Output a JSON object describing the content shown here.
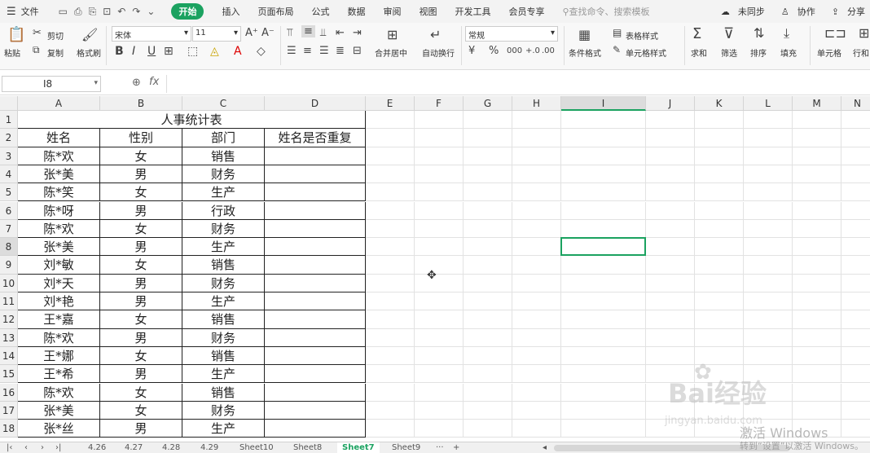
{
  "menubar": {
    "file": "文件",
    "tabs": [
      {
        "label": "开始",
        "active": true
      },
      {
        "label": "插入"
      },
      {
        "label": "页面布局"
      },
      {
        "label": "公式"
      },
      {
        "label": "数据"
      },
      {
        "label": "审阅"
      },
      {
        "label": "视图"
      },
      {
        "label": "开发工具"
      },
      {
        "label": "会员专享"
      }
    ],
    "search": "查找命令、搜索模板",
    "unsync": "未同步",
    "collab": "协作",
    "share": "分享"
  },
  "ribbon": {
    "paste": "粘贴",
    "cut": "剪切",
    "copy": "复制",
    "format_painter": "格式刷",
    "font_name": "宋体",
    "font_size": "11",
    "merge": "合并居中",
    "wrap": "自动换行",
    "number_format": "常规",
    "cond_format": "条件格式",
    "table_style": "表格样式",
    "cell_style": "单元格样式",
    "sum": "求和",
    "filter": "筛选",
    "sort": "排序",
    "fill": "填充",
    "cell": "单元格",
    "rowcol": "行和"
  },
  "formula_bar": {
    "name_box": "I8",
    "fx": "fx",
    "content": ""
  },
  "columns": [
    "A",
    "B",
    "C",
    "D",
    "E",
    "F",
    "G",
    "H",
    "I",
    "J",
    "K",
    "L",
    "M",
    "N"
  ],
  "rows": [
    "1",
    "2",
    "3",
    "4",
    "5",
    "6",
    "7",
    "8",
    "9",
    "10",
    "11",
    "12",
    "13",
    "14",
    "15",
    "16",
    "17",
    "18"
  ],
  "sheet": {
    "title": "人事统计表",
    "headers": [
      "姓名",
      "性别",
      "部门",
      "姓名是否重复"
    ],
    "records": [
      [
        "陈*欢",
        "女",
        "销售",
        ""
      ],
      [
        "张*美",
        "男",
        "财务",
        ""
      ],
      [
        "陈*笑",
        "女",
        "生产",
        ""
      ],
      [
        "陈*呀",
        "男",
        "行政",
        ""
      ],
      [
        "陈*欢",
        "女",
        "财务",
        ""
      ],
      [
        "张*美",
        "男",
        "生产",
        ""
      ],
      [
        "刘*敏",
        "女",
        "销售",
        ""
      ],
      [
        "刘*天",
        "男",
        "财务",
        ""
      ],
      [
        "刘*艳",
        "男",
        "生产",
        ""
      ],
      [
        "王*嘉",
        "女",
        "销售",
        ""
      ],
      [
        "陈*欢",
        "男",
        "财务",
        ""
      ],
      [
        "王*娜",
        "女",
        "销售",
        ""
      ],
      [
        "王*希",
        "男",
        "生产",
        ""
      ],
      [
        "陈*欢",
        "女",
        "销售",
        ""
      ],
      [
        "张*美",
        "女",
        "财务",
        ""
      ],
      [
        "张*丝",
        "男",
        "生产",
        ""
      ]
    ]
  },
  "sheet_tabs": [
    {
      "label": "4.26"
    },
    {
      "label": "4.27"
    },
    {
      "label": "4.28"
    },
    {
      "label": "4.29"
    },
    {
      "label": "Sheet10"
    },
    {
      "label": "Sheet8"
    },
    {
      "label": "Sheet7",
      "active": true
    },
    {
      "label": "Sheet9"
    },
    {
      "label": "···"
    },
    {
      "label": "+"
    }
  ],
  "watermark": {
    "baidu": "Bai经验",
    "url": "jingyan.baidu.com",
    "activate": "激活 Windows",
    "activate_sub": "转到“设置”以激活 Windows。"
  },
  "colors": {
    "accent": "#1ba260",
    "grid": "#e2e2e2",
    "header_bg": "#f0f0f0"
  }
}
